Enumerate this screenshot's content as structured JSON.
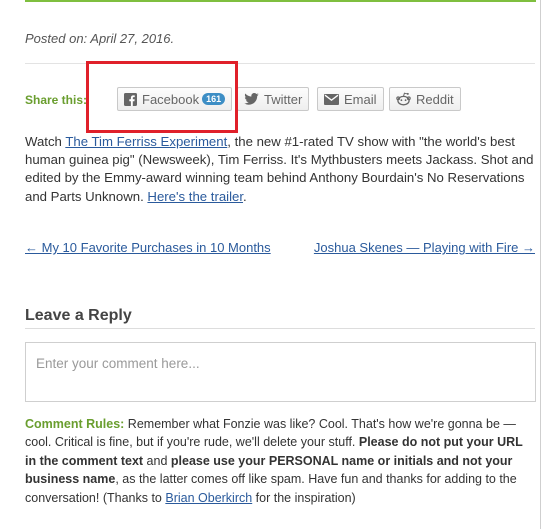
{
  "post": {
    "posted_on": "Posted on: April 27, 2016."
  },
  "share": {
    "label": "Share this:",
    "buttons": [
      {
        "label": "Facebook",
        "count": "161",
        "icon": "facebook-icon"
      },
      {
        "label": "Twitter",
        "icon": "twitter-icon"
      },
      {
        "label": "Email",
        "icon": "email-icon"
      },
      {
        "label": "Reddit",
        "icon": "reddit-icon"
      }
    ],
    "highlight_color": "#e0202a"
  },
  "body": {
    "t1": "Watch ",
    "link1": "The Tim Ferriss Experiment",
    "t2": ", the new #1-rated TV show with \"the world's best human guinea pig\" (Newsweek), Tim Ferriss. It's Mythbusters meets Jackass. Shot and edited by the Emmy-award winning team behind Anthony Bourdain's No Reservations and Parts Unknown. ",
    "link2": "Here's the trailer",
    "t3": "."
  },
  "nav": {
    "prev": "← My 10 Favorite Purchases in 10 Months",
    "next": "Joshua Skenes — Playing with Fire →"
  },
  "reply": {
    "heading": "Leave a Reply",
    "placeholder": "Enter your comment here..."
  },
  "rules": {
    "label": "Comment Rules:",
    "t1": " Remember what Fonzie was like? Cool. That's how we're gonna be — cool. Critical is fine, but if you're rude, we'll delete your stuff. ",
    "b1": "Please do not put your URL in the comment text",
    "t2": " and ",
    "b2": "please use your PERSONAL name or initials and not your business name",
    "t3": ", as the latter comes off like spam. Have fun and thanks for adding to the conversation! (Thanks to ",
    "link": "Brian Oberkirch",
    "t4": " for the inspiration)"
  },
  "colors": {
    "accent_green": "#6a9e2f",
    "link_blue": "#2a5a9c",
    "badge_blue": "#3d8ec5"
  }
}
